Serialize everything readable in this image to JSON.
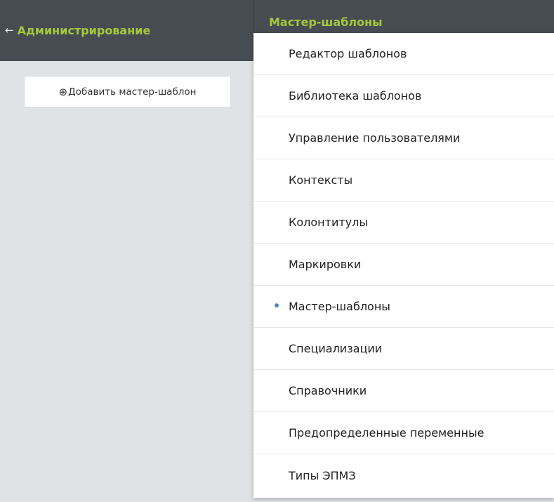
{
  "left_panel": {
    "back_arrow": "←",
    "title": "Администрирование",
    "add_button": {
      "icon": "⊕",
      "label": "Добавить мастер-шаблон"
    }
  },
  "right_panel": {
    "title": "Мастер-шаблоны"
  },
  "menu": {
    "items": [
      {
        "label": "Редактор шаблонов",
        "active": false
      },
      {
        "label": "Библиотека шаблонов",
        "active": false
      },
      {
        "label": "Управление пользователями",
        "active": false
      },
      {
        "label": "Контексты",
        "active": false
      },
      {
        "label": "Колонтитулы",
        "active": false
      },
      {
        "label": "Маркировки",
        "active": false
      },
      {
        "label": "Мастер-шаблоны",
        "active": true
      },
      {
        "label": "Специализации",
        "active": false
      },
      {
        "label": "Справочники",
        "active": false
      },
      {
        "label": "Предопределенные переменные",
        "active": false
      },
      {
        "label": "Типы ЭПМЗ",
        "active": false
      }
    ]
  },
  "colors": {
    "header_bg": "#464c52",
    "accent_green": "#a6c83a",
    "panel_bg": "#dfe3e5",
    "active_dot": "#5b86b3"
  }
}
